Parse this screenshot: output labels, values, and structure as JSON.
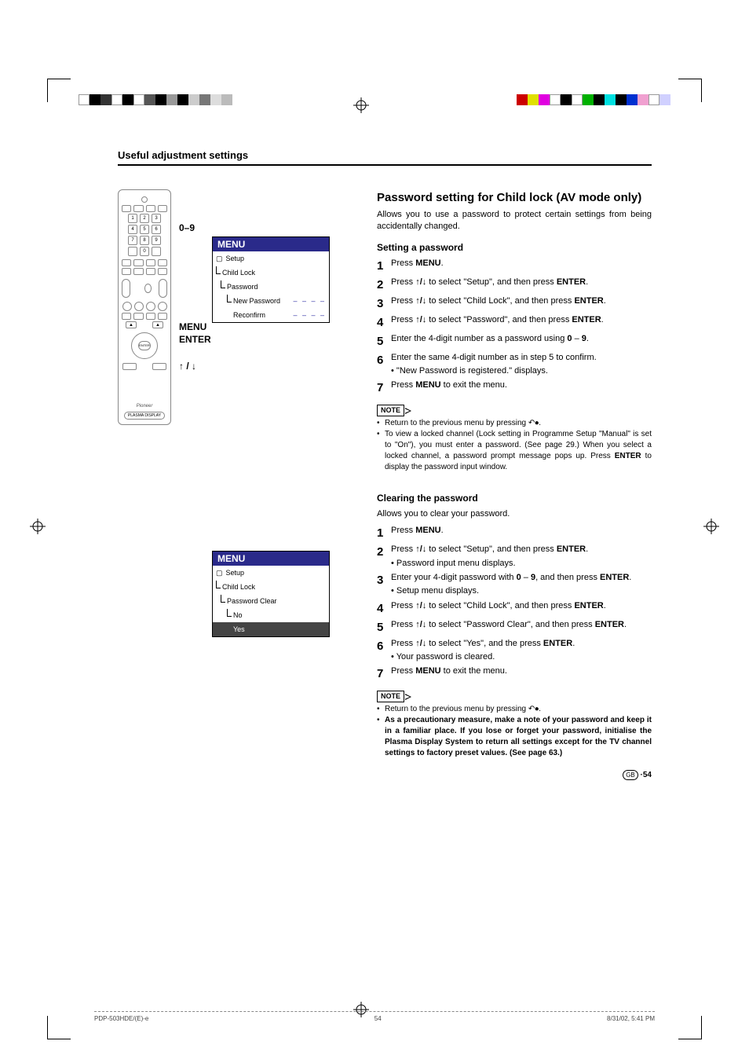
{
  "section_title": "Useful adjustment settings",
  "remote_labels": {
    "digits": "0–9",
    "menu": "MENU",
    "enter": "ENTER",
    "arrows": "↑ / ↓"
  },
  "remote": {
    "enter_label": "ENTER",
    "brand": "Pioneer",
    "bottom_label": "PLASMA DISPLAY",
    "num1": "1",
    "num2": "2",
    "num3": "3",
    "num4": "4",
    "num5": "5",
    "num6": "6",
    "num7": "7",
    "num8": "8",
    "num9": "9",
    "num0": "0"
  },
  "menu1": {
    "header": "MENU",
    "setup": "Setup",
    "child_lock": "Child Lock",
    "password": "Password",
    "new_password": "New Password",
    "reconfirm": "Reconfirm",
    "dashes": "– – – –"
  },
  "menu2": {
    "header": "MENU",
    "setup": "Setup",
    "child_lock": "Child Lock",
    "password_clear": "Password Clear",
    "no": "No",
    "yes": "Yes"
  },
  "main_heading": "Password setting for Child lock (AV mode only)",
  "main_intro": "Allows you to use a password to protect certain settings from being accidentally changed.",
  "setting": {
    "heading": "Setting a password",
    "s1_a": "Press ",
    "s1_b": "MENU",
    "s1_c": ".",
    "s2_a": "Press ",
    "s2_b": " to select \"Setup\", and then press ",
    "s2_c": "ENTER",
    "s2_d": ".",
    "s3_a": "Press ",
    "s3_b": " to select \"Child Lock\", and then press ",
    "s3_c": "ENTER",
    "s3_d": ".",
    "s4_a": "Press ",
    "s4_b": " to select \"Password\", and then press ",
    "s4_c": "ENTER",
    "s4_d": ".",
    "s5_a": "Enter the 4-digit number as a password using ",
    "s5_b": "0",
    "s5_c": " – ",
    "s5_d": "9",
    "s5_e": ".",
    "s6": "Enter the same 4-digit number as in step 5 to confirm.",
    "s6_sub": "\"New Password is registered.\" displays.",
    "s7_a": "Press ",
    "s7_b": "MENU",
    "s7_c": " to exit the menu."
  },
  "note_label": "NOTE",
  "notes1": {
    "n1": "Return to the previous menu by pressing ",
    "n2_a": "To view a locked channel (Lock setting in Programme Setup \"Manual\" is set to \"On\"), you must enter a password. (See page 29.) When you select a locked channel, a password prompt message pops up. Press ",
    "n2_b": "ENTER",
    "n2_c": " to display the password input window."
  },
  "clearing": {
    "heading": "Clearing the password",
    "intro": "Allows you to clear your password.",
    "s1_a": "Press ",
    "s1_b": "MENU",
    "s1_c": ".",
    "s2_a": "Press ",
    "s2_b": " to select \"Setup\", and then press ",
    "s2_c": "ENTER",
    "s2_d": ".",
    "s2_sub": "Password input menu displays.",
    "s3_a": "Enter your 4-digit password with ",
    "s3_b": "0",
    "s3_c": " – ",
    "s3_d": "9",
    "s3_e": ", and then press ",
    "s3_f": "ENTER",
    "s3_g": ".",
    "s3_sub": "Setup menu displays.",
    "s4_a": "Press ",
    "s4_b": " to select \"Child Lock\", and then press ",
    "s4_c": "ENTER",
    "s4_d": ".",
    "s5_a": "Press ",
    "s5_b": " to select \"Password Clear\", and then press ",
    "s5_c": "ENTER",
    "s5_d": ".",
    "s6_a": "Press ",
    "s6_b": " to select \"Yes\", and the press ",
    "s6_c": "ENTER",
    "s6_d": ".",
    "s6_sub": "Your password is cleared.",
    "s7_a": "Press ",
    "s7_b": "MENU",
    "s7_c": " to exit the menu."
  },
  "notes2": {
    "n1": "Return to the previous menu by pressing ",
    "n2": "As a precautionary measure, make a note of your password  and keep it in a familiar place. If you lose or forget your password, initialise the Plasma Display System to return all settings except for the TV channel settings to factory preset values. (See page 63.)"
  },
  "page_number_label": "GB",
  "page_number": " ·54",
  "footer": {
    "left": "PDP-503HDE/(E)-e",
    "mid": "54",
    "right": "8/31/02, 5:41 PM"
  }
}
